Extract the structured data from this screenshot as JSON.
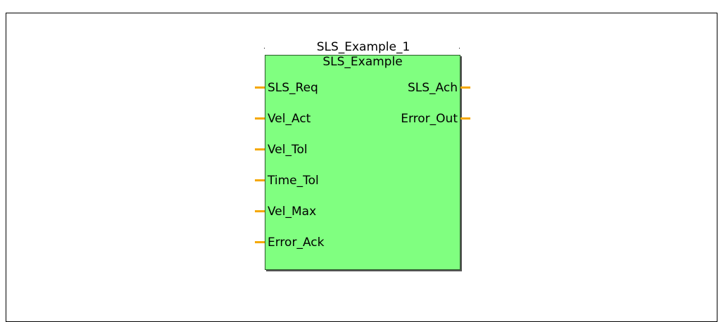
{
  "block": {
    "instance_name": "SLS_Example_1",
    "type_name": "SLS_Example",
    "fill_color": "#80ff80",
    "pin_color": "#f5a800"
  },
  "inputs": [
    {
      "label": "SLS_Req"
    },
    {
      "label": "Vel_Act"
    },
    {
      "label": "Vel_Tol"
    },
    {
      "label": "Time_Tol"
    },
    {
      "label": "Vel_Max"
    },
    {
      "label": "Error_Ack"
    }
  ],
  "outputs": [
    {
      "label": "SLS_Ach"
    },
    {
      "label": "Error_Out"
    }
  ]
}
